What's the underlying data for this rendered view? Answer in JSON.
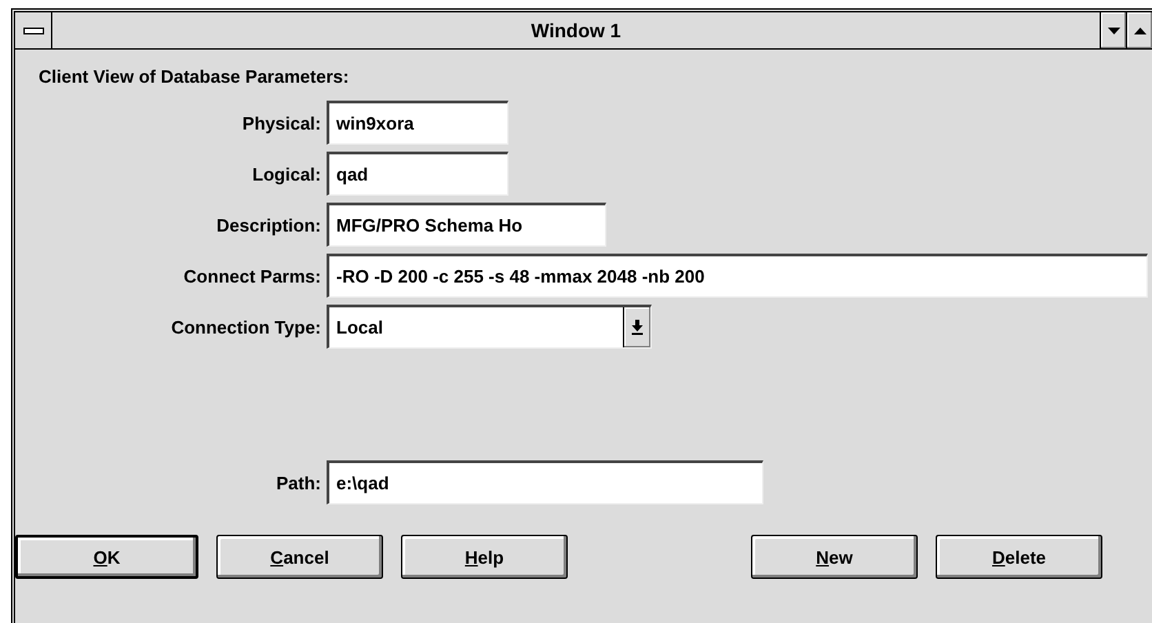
{
  "window": {
    "title": "Window 1"
  },
  "heading": "Client View of Database Parameters:",
  "fields": [
    {
      "kind": "text",
      "label": "Physical:",
      "value": "win9xora"
    },
    {
      "kind": "text",
      "label": "Logical:",
      "value": "qad"
    },
    {
      "kind": "text",
      "label": "Description:",
      "value": "MFG/PRO Schema Ho"
    },
    {
      "kind": "text",
      "label": "Connect Parms:",
      "value": "-RO -D 200 -c 255 -s 48 -mmax 2048 -nb 200"
    },
    {
      "kind": "combo",
      "label": "Connection Type:",
      "value": "Local"
    },
    {
      "kind": "text",
      "label": "Path:",
      "value": "e:\\qad"
    }
  ],
  "buttons": [
    {
      "label": "OK",
      "default": true
    },
    {
      "label": "Cancel",
      "default": false
    },
    {
      "label": "Help",
      "default": false
    },
    {
      "label": "New",
      "default": false
    },
    {
      "label": "Delete",
      "default": false
    }
  ]
}
